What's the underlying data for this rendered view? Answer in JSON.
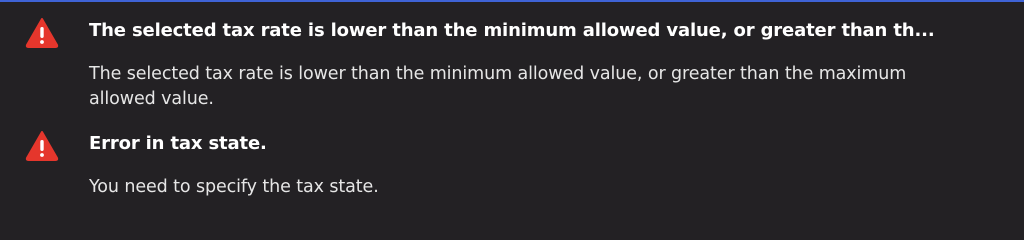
{
  "colors": {
    "background": "#232124",
    "accent_bar": "#3f63d6",
    "warning_icon": "#e5362c",
    "title_text": "#ffffff",
    "message_text": "#e6e6e6"
  },
  "errors": [
    {
      "icon": "warning-triangle-icon",
      "title": "The selected tax rate is lower than the minimum allowed value, or greater than th...",
      "message": "The selected tax rate is lower than the minimum allowed value, or greater than the maximum allowed value."
    },
    {
      "icon": "warning-triangle-icon",
      "title": "Error in tax state.",
      "message": "You need to specify the tax state."
    }
  ]
}
